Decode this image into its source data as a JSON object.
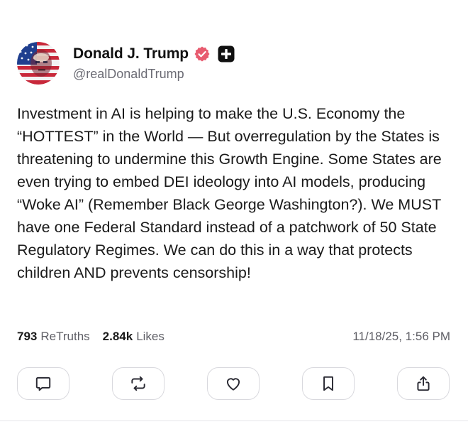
{
  "post": {
    "display_name": "Donald J. Trump",
    "handle": "@realDonaldTrump",
    "verified_icon": "verified-badge-icon",
    "plus_icon": "plus-badge-icon",
    "accent_color": "#e85b6f",
    "body": "Investment in AI is helping to make the U.S. Economy the “HOTTEST” in the World — But overregulation by the States is threatening to undermine this Growth Engine. Some States are even trying to embed DEI ideology into AI models, producing “Woke AI” (Remember Black George Washington?). We MUST have one Federal Standard instead of a patchwork of 50 State Regulatory Regimes. We can do this in a way that protects children AND prevents censorship!",
    "retruths_count": "793",
    "retruths_label": "ReTruths",
    "likes_count": "2.84k",
    "likes_label": "Likes",
    "timestamp": "11/18/25, 1:56 PM"
  },
  "actions": [
    {
      "name": "reply",
      "icon": "comment-icon"
    },
    {
      "name": "retruth",
      "icon": "repost-icon"
    },
    {
      "name": "like",
      "icon": "heart-icon"
    },
    {
      "name": "bookmark",
      "icon": "bookmark-icon"
    },
    {
      "name": "share",
      "icon": "share-icon"
    }
  ]
}
